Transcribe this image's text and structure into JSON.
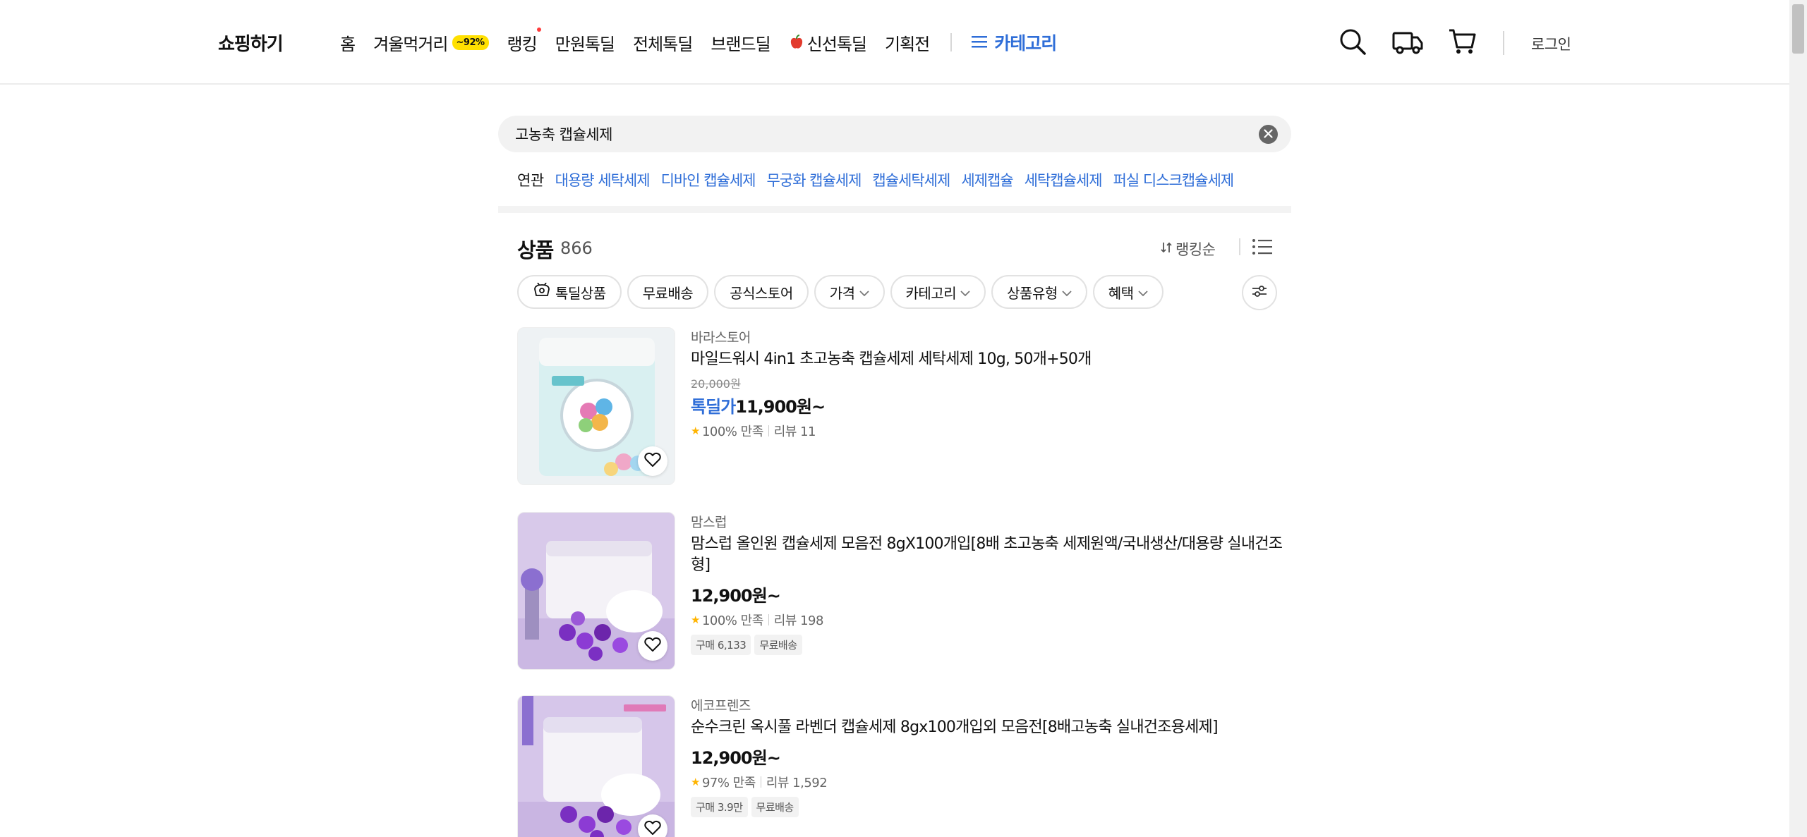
{
  "header": {
    "brand": "쇼핑하기",
    "nav": [
      {
        "label": "홈"
      },
      {
        "label": "겨울먹거리",
        "badge": "~92%"
      },
      {
        "label": "랭킹",
        "dot": true
      },
      {
        "label": "만원톡딜"
      },
      {
        "label": "전체톡딜"
      },
      {
        "label": "브랜드딜"
      },
      {
        "label": "신선톡딜",
        "icon": "apple-icon"
      },
      {
        "label": "기획전"
      }
    ],
    "category_label": "카테고리",
    "icons": [
      "search-icon",
      "delivery-truck-icon",
      "cart-icon"
    ],
    "login_label": "로그인",
    "accent_color": "#2f6ed8"
  },
  "search": {
    "value": "고농축 캡슐세제"
  },
  "related": {
    "label": "연관",
    "tags": [
      "대용량 세탁세제",
      "디바인 캡슐세제",
      "무궁화 캡슐세제",
      "캡슐세탁세제",
      "세제캡슐",
      "세탁캡슐세제",
      "퍼실 디스크캡슐세제"
    ]
  },
  "products_header": {
    "title": "상품",
    "count": "866",
    "sort_label": "랭킹순"
  },
  "filters": [
    {
      "label": "톡딜상품",
      "icon": "deal-icon"
    },
    {
      "label": "무료배송"
    },
    {
      "label": "공식스토어"
    },
    {
      "label": "가격",
      "dropdown": true
    },
    {
      "label": "카테고리",
      "dropdown": true
    },
    {
      "label": "상품유형",
      "dropdown": true
    },
    {
      "label": "혜택",
      "dropdown": true
    }
  ],
  "products": [
    {
      "store": "바라스토어",
      "name": "마일드워시 4in1 초고농축 캡슐세제 세탁세제 10g, 50개+50개",
      "original_price": "20,000원",
      "deal_label": "톡딜가",
      "price": "11,900원~",
      "rating": "100% 만족",
      "reviews": "리뷰 11",
      "tags": []
    },
    {
      "store": "맘스럽",
      "name": "맘스럽 올인원 캡슐세제 모음전 8gX100개입[8배 초고농축 세제원액/국내생산/대용량 실내건조형]",
      "original_price": "",
      "deal_label": "",
      "price": "12,900원~",
      "rating": "100% 만족",
      "reviews": "리뷰 198",
      "tags": [
        "구매 6,133",
        "무료배송"
      ]
    },
    {
      "store": "에코프렌즈",
      "name": "순수크린 옥시풀 라벤더 캡슐세제 8gx100개입외 모음전[8배고농축 실내건조용세제]",
      "original_price": "",
      "deal_label": "",
      "price": "12,900원~",
      "rating": "97% 만족",
      "reviews": "리뷰 1,592",
      "tags": [
        "구매 3.9만",
        "무료배송"
      ]
    }
  ]
}
